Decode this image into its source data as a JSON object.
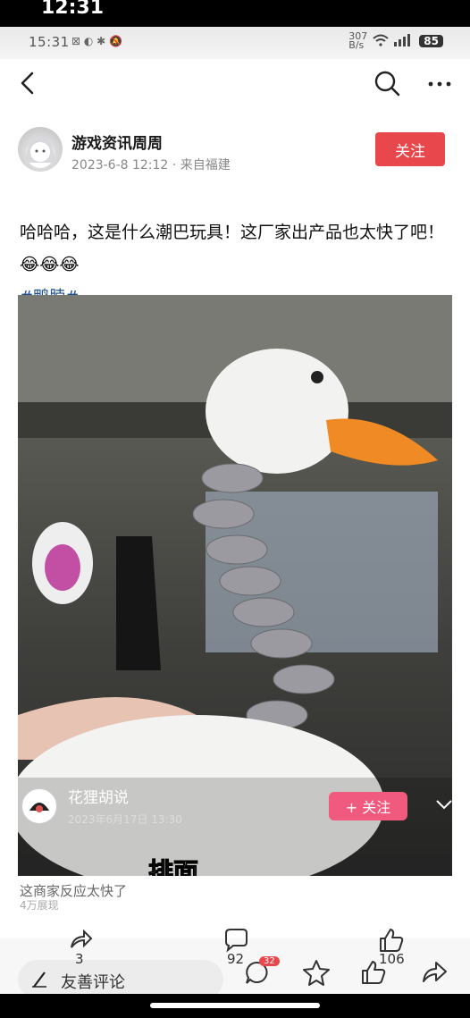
{
  "status_bar": {
    "ghost_time": "12:31",
    "time": "15:31",
    "net_speed": "307\nB/s",
    "signal_labels": "4G 4G",
    "battery": "85"
  },
  "nav": {
    "back_icon": "chevron-left-icon",
    "search_icon": "search-icon",
    "more_icon": "more-dots-icon"
  },
  "post": {
    "author_name": "游戏资讯周周",
    "meta": "2023-6-8 12:12 · 来自福建",
    "follow_label": "关注",
    "text": "哈哈哈，这是什么潮巴玩具！这厂家出产品也太快了吧！😂😂😂",
    "hashtag": "#鸭脖#"
  },
  "video": {
    "uploader": "花狸胡说",
    "upload_date": "2023年6月17日 13:30",
    "follow_label": "+ 关注",
    "subtitle": "排面",
    "description": "这商家反应太快了",
    "description_sub": "4万展现"
  },
  "bottom_bar": {
    "comment_placeholder": "友善评论",
    "repost_count": "3",
    "comment_count": "92",
    "comment_badge": "32",
    "like_count": "106",
    "accent": "#e8484c"
  }
}
